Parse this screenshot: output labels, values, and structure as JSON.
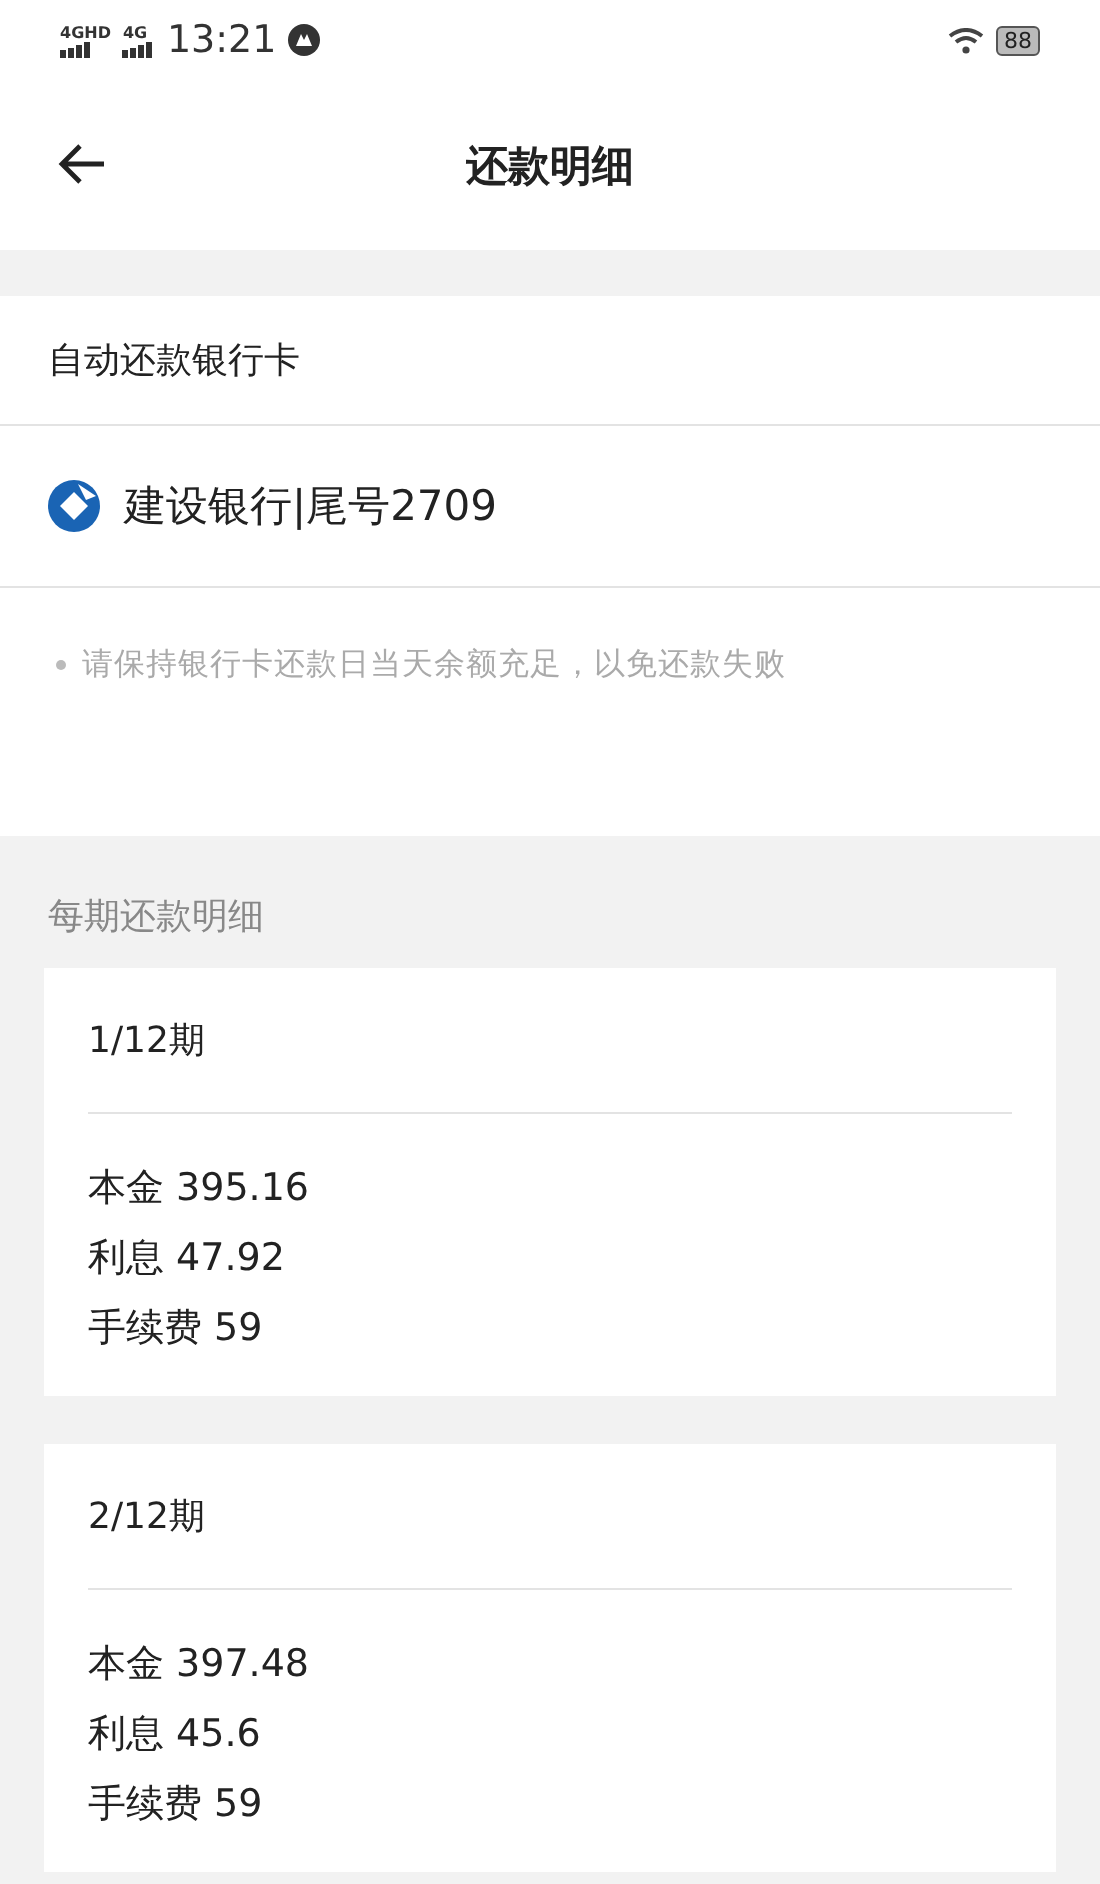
{
  "status_bar": {
    "network_1": "4GHD",
    "network_2": "4G",
    "time": "13:21",
    "battery": "88"
  },
  "header": {
    "title": "还款明细"
  },
  "autopay": {
    "label": "自动还款银行卡",
    "bank": "建设银行|尾号2709",
    "tip": "请保持银行卡还款日当天余额充足，以免还款失败"
  },
  "schedule": {
    "heading": "每期还款明细",
    "periods": [
      {
        "title": "1/12期",
        "lines": [
          {
            "label": "本金",
            "value": "395.16"
          },
          {
            "label": "利息",
            "value": "47.92"
          },
          {
            "label": "手续费",
            "value": "59"
          }
        ]
      },
      {
        "title": "2/12期",
        "lines": [
          {
            "label": "本金",
            "value": "397.48"
          },
          {
            "label": "利息",
            "value": "45.6"
          },
          {
            "label": "手续费",
            "value": "59"
          }
        ]
      }
    ]
  }
}
